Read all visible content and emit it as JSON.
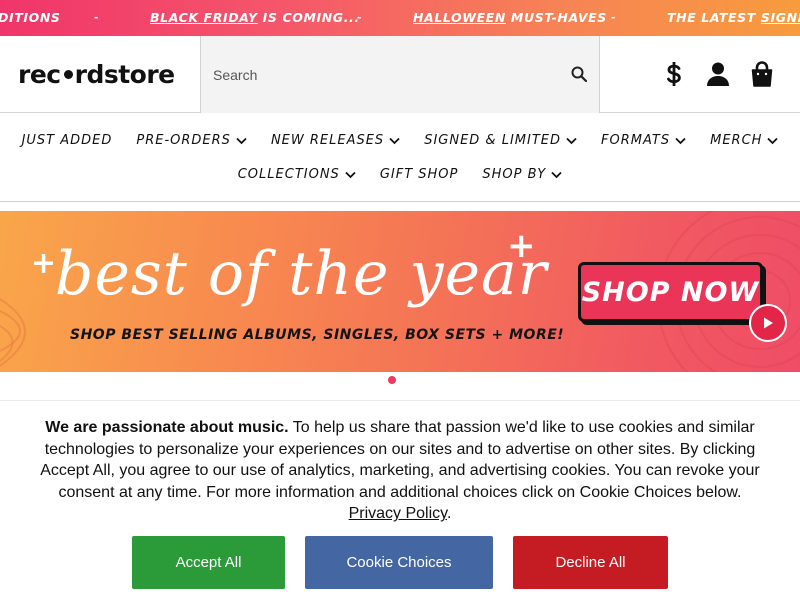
{
  "ticker": {
    "items": [
      {
        "pre": "",
        "u": "",
        "post": "DITIONS"
      },
      {
        "pre": "",
        "u": "BLACK FRIDAY",
        "post": " IS COMING..."
      },
      {
        "pre": "",
        "u": "HALLOWEEN",
        "post": " MUST-HAVES"
      },
      {
        "pre": "THE LATEST ",
        "u": "SIGNED",
        "post": ""
      }
    ],
    "separator": "-"
  },
  "header": {
    "logo_left": "rec",
    "logo_right": "rdstore",
    "search_placeholder": "Search",
    "icons": [
      "dollar-icon",
      "account-icon",
      "cart-icon"
    ]
  },
  "nav": {
    "row1": [
      "JUST ADDED",
      "PRE-ORDERS",
      "NEW RELEASES",
      "SIGNED & LIMITED",
      "FORMATS",
      "MERCH"
    ],
    "row2": [
      "COLLECTIONS",
      "GIFT SHOP",
      "SHOP BY"
    ],
    "has_dropdown": {
      "PRE-ORDERS": true,
      "NEW RELEASES": true,
      "SIGNED & LIMITED": true,
      "FORMATS": true,
      "MERCH": true,
      "COLLECTIONS": true,
      "SHOP BY": true
    }
  },
  "hero": {
    "title": "best of the year",
    "subtitle": "SHOP BEST SELLING ALBUMS, SINGLES, BOX SETS + MORE!",
    "cta": "SHOP NOW",
    "slide_count": 1,
    "active_slide": 1
  },
  "cookie": {
    "lead": "We are passionate about music.",
    "body": " To help us share that passion we'd like to use cookies and similar technologies to personalize your experiences on our sites and to advertise on other sites. By clicking Accept All, you agree to our use of analytics, marketing, and advertising cookies. You can revoke your consent at any time. For more information and additional choices click on Cookie Choices below.",
    "privacy_link": "Privacy Policy",
    "privacy_suffix": ".",
    "buttons": {
      "accept": "Accept All",
      "choices": "Cookie Choices",
      "decline": "Decline All"
    }
  },
  "colors": {
    "accept": "#2b9a39",
    "choices": "#4467a3",
    "decline": "#c51c24",
    "brand_pink": "#ea3559"
  }
}
